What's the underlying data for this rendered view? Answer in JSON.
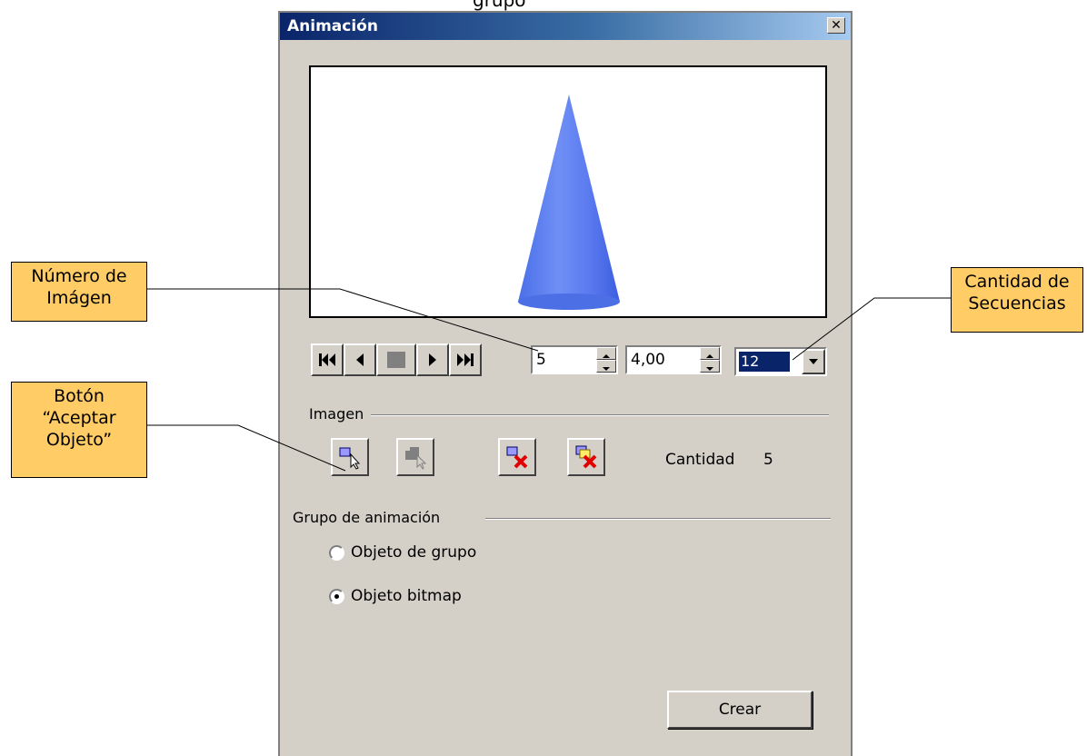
{
  "window": {
    "title": "Animación"
  },
  "top_text": "grupo",
  "playback": {
    "buttons": [
      "first-icon",
      "previous-icon",
      "stop-icon",
      "play-icon",
      "last-icon"
    ],
    "image_number": "5",
    "duration": "4,00",
    "loop_count": "12"
  },
  "imagen": {
    "label": "Imagen",
    "cantidad_label": "Cantidad",
    "cantidad_value": "5"
  },
  "grupo": {
    "label": "Grupo de animación",
    "options": [
      {
        "label": "Objeto de grupo",
        "checked": false
      },
      {
        "label": "Objeto bitmap",
        "checked": true
      }
    ]
  },
  "create_label": "Crear",
  "annotations": {
    "numero": "Número de\nImágen",
    "boton": "Botón\n“Aceptar\nObjeto”",
    "cantidad": "Cantidad de\nSecuencias"
  },
  "colors": {
    "callout": "#ffcc66",
    "titlebar": "#0a246a",
    "cone": "#5577ee"
  }
}
